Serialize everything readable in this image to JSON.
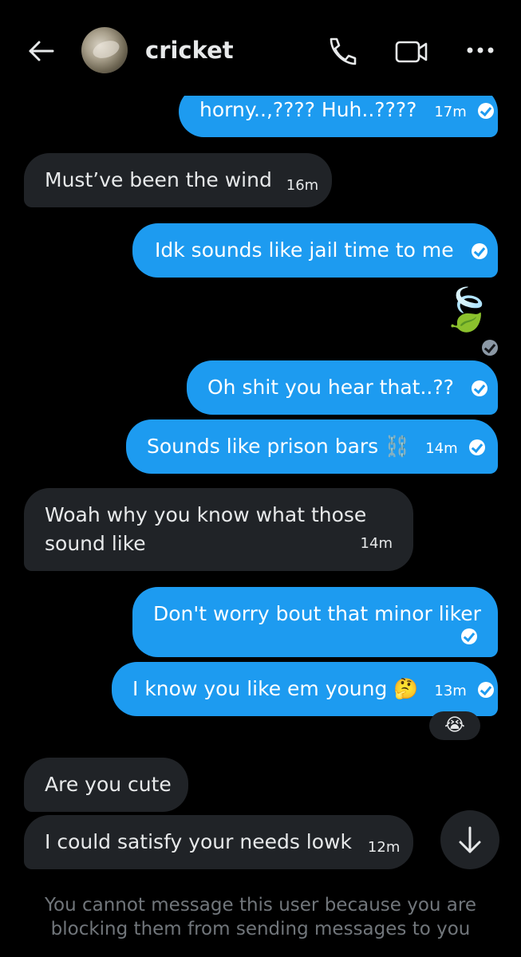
{
  "header": {
    "contact_name": "cricket",
    "back_icon": "arrow-left-icon",
    "call_icon": "phone-icon",
    "video_icon": "video-icon",
    "more_icon": "more-horizontal-icon"
  },
  "messages": [
    {
      "text": "horny..,???? Huh..????",
      "time": "17m"
    },
    {
      "text": "Must’ve been the wind",
      "time": "16m"
    },
    {
      "text": "Idk sounds like jail time to me",
      "time": ""
    },
    {
      "text": "🍃",
      "time": ""
    },
    {
      "text": "Oh shit you hear that..??",
      "time": ""
    },
    {
      "text": "Sounds like prison bars ⛓️",
      "time": "14m"
    },
    {
      "text": "Woah why you know what those sound like",
      "time": "14m"
    },
    {
      "text": "Don't worry bout that minor liker",
      "time": ""
    },
    {
      "text": "I know you like em young 🤔",
      "time": "13m"
    },
    {
      "text": "😭",
      "time": ""
    },
    {
      "text": "Are you cute",
      "time": ""
    },
    {
      "text": "I could satisfy your needs lowk",
      "time": "12m"
    }
  ],
  "footer": {
    "notice": "You cannot message this user because you are blocking them from sending messages to you"
  },
  "colors": {
    "sent_bubble": "#1d9bf0",
    "received_bubble": "#202327",
    "background": "#000000"
  }
}
